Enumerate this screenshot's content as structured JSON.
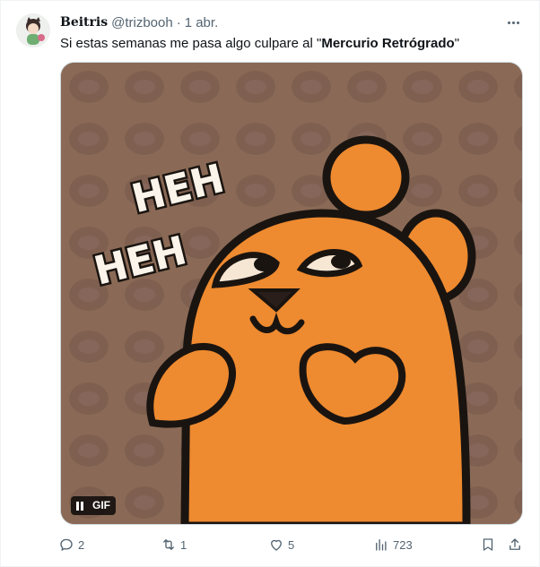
{
  "tweet": {
    "display_name": "Beitris",
    "handle": "@trizbooh",
    "separator": "·",
    "time": "1 abr.",
    "text_prefix": "Si estas semanas me pasa algo culpare al \"",
    "text_bold": "Mercurio Retrógrado",
    "text_suffix": "\""
  },
  "media": {
    "type": "gif",
    "badge_label": "GIF",
    "caption_line1": "HEH",
    "caption_line2": "HEH"
  },
  "actions": {
    "reply_count": "2",
    "retweet_count": "1",
    "like_count": "5",
    "views_count": "723"
  },
  "colors": {
    "meta_text": "#536471",
    "gif_background": "#8a6a56",
    "character_orange": "#ee8a2f"
  },
  "icons": [
    "more-icon",
    "pause-icon",
    "reply-icon",
    "retweet-icon",
    "like-icon",
    "views-icon",
    "bookmark-icon",
    "share-icon"
  ]
}
